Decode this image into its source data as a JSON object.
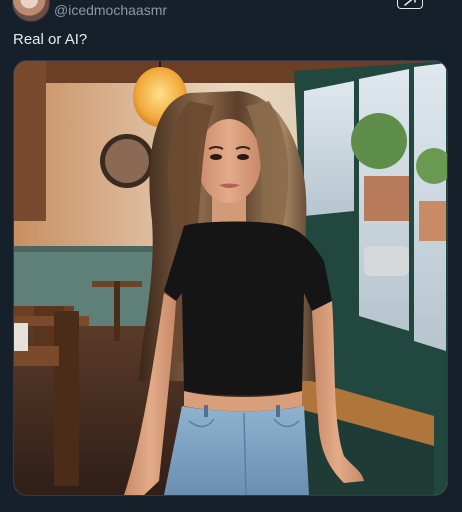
{
  "author": {
    "handle": "@icedmochaasmr"
  },
  "post": {
    "text": "Real or AI?"
  },
  "icons": {
    "avatar": "profile-avatar",
    "grok": "grok-icon"
  },
  "colors": {
    "background": "#15202b",
    "text": "#e7e9ea",
    "muted": "#8b98a5",
    "border": "#2f3b47"
  }
}
